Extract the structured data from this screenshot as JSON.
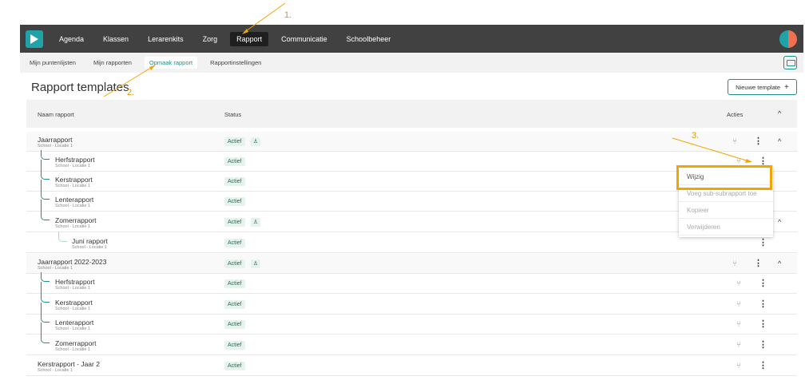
{
  "nav": {
    "items": [
      "Agenda",
      "Klassen",
      "Lerarenkits",
      "Zorg",
      "Rapport",
      "Communicatie",
      "Schoolbeheer"
    ],
    "active": "Rapport"
  },
  "subnav": {
    "items": [
      "Mijn puntenlijsten",
      "Mijn rapporten",
      "Opmaak rapport",
      "Rapportinstellingen"
    ],
    "active": "Opmaak rapport"
  },
  "page": {
    "title": "Rapport templates",
    "new_button": "Nieuwe template",
    "new_button_icon": "+"
  },
  "table": {
    "headers": {
      "name": "Naam rapport",
      "status": "Status",
      "actions": "Acties"
    },
    "rows": [
      {
        "name": "Jaarrapport",
        "subtitle": "School - Locatie 1",
        "status": "Actief",
        "level": 0
      },
      {
        "name": "Herfstrapport",
        "subtitle": "School - Locatie 1",
        "status": "Actief",
        "level": 1
      },
      {
        "name": "Kerstrapport",
        "subtitle": "School - Locatie 1",
        "status": "Actief",
        "level": 1
      },
      {
        "name": "Lenterapport",
        "subtitle": "School - Locatie 1",
        "status": "Actief",
        "level": 1
      },
      {
        "name": "Zomerrapport",
        "subtitle": "School - Locatie 1",
        "status": "Actief",
        "level": 1
      },
      {
        "name": "Juni rapport",
        "subtitle": "School - Locatie 1",
        "status": "Actief",
        "level": 2
      },
      {
        "name": "Jaarrapport 2022-2023",
        "subtitle": "School - Locatie 1",
        "status": "Actief",
        "level": 0
      },
      {
        "name": "Herfstrapport",
        "subtitle": "School - Locatie 1",
        "status": "Actief",
        "level": 1
      },
      {
        "name": "Kerstrapport",
        "subtitle": "School - Locatie 1",
        "status": "Actief",
        "level": 1
      },
      {
        "name": "Lenterapport",
        "subtitle": "School - Locatie 1",
        "status": "Actief",
        "level": 1
      },
      {
        "name": "Zomerrapport",
        "subtitle": "School - Locatie 1",
        "status": "Actief",
        "level": 1
      },
      {
        "name": "Kerstrapport - Jaar 2",
        "subtitle": "School - Locatie 1",
        "status": "Actief",
        "level": 0
      }
    ]
  },
  "menu": {
    "items": [
      "Wijzig",
      "Voeg sub-subrapport toe",
      "Kopieer",
      "Verwijderen"
    ]
  },
  "annotations": [
    "1.",
    "2.",
    "3."
  ],
  "colors": {
    "accent": "#1f8f8a",
    "highlight": "#f0a500",
    "nav_bg": "#414141"
  },
  "icons": {
    "caret_up": "^",
    "kebab": "⋮",
    "branch": "⑂",
    "user": "♙"
  }
}
